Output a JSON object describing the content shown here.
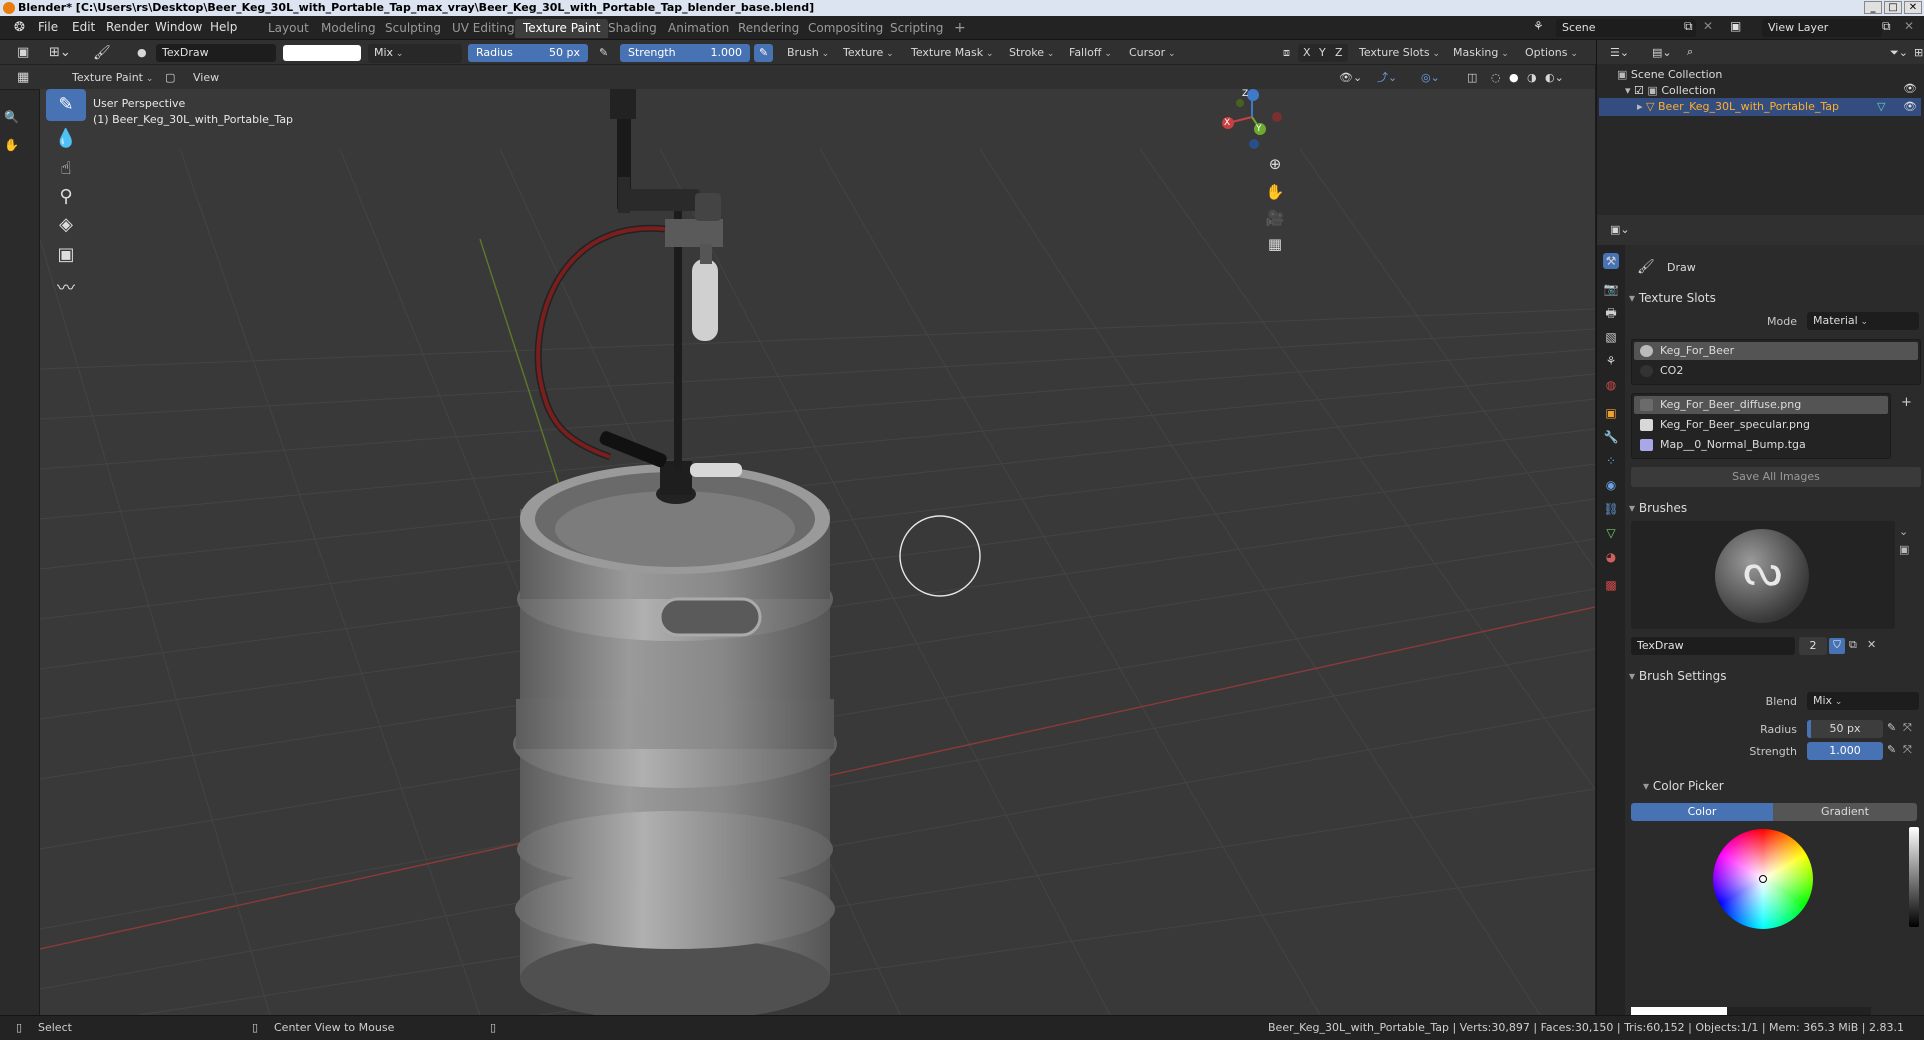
{
  "window": {
    "title": "Blender* [C:\\Users\\rs\\Desktop\\Beer_Keg_30L_with_Portable_Tap_max_vray\\Beer_Keg_30L_with_Portable_Tap_blender_base.blend]"
  },
  "menu": [
    "File",
    "Edit",
    "Render",
    "Window",
    "Help"
  ],
  "workspaces": [
    {
      "label": "Layout",
      "active": false
    },
    {
      "label": "Modeling",
      "active": false
    },
    {
      "label": "Sculpting",
      "active": false
    },
    {
      "label": "UV Editing",
      "active": false
    },
    {
      "label": "Texture Paint",
      "active": true
    },
    {
      "label": "Shading",
      "active": false
    },
    {
      "label": "Animation",
      "active": false
    },
    {
      "label": "Rendering",
      "active": false
    },
    {
      "label": "Compositing",
      "active": false
    },
    {
      "label": "Scripting",
      "active": false
    }
  ],
  "workspace_add": "+",
  "scene": {
    "label": "Scene",
    "view_layer": "View Layer"
  },
  "toolheader": {
    "brush_name": "TexDraw",
    "blend_mode": "Mix",
    "radius_label": "Radius",
    "radius_value": "50 px",
    "strength_label": "Strength",
    "strength_value": "1.000",
    "brush_color": "#ffffff",
    "dropdowns": [
      "Brush",
      "Texture",
      "Texture Mask",
      "Stroke",
      "Falloff",
      "Cursor"
    ],
    "axes": [
      "X",
      "Y",
      "Z"
    ],
    "right_dropdowns": [
      "Texture Slots",
      "Masking",
      "Options"
    ]
  },
  "viewheader": {
    "mode": "Texture Paint",
    "view": "View"
  },
  "viewport": {
    "perspective_label": "User Perspective",
    "object_label": "(1) Beer_Keg_30L_with_Portable_Tap",
    "axis_x": "X",
    "axis_y": "Y",
    "axis_z": "Z"
  },
  "outliner": {
    "root": "Scene Collection",
    "collection": "Collection",
    "object": "Beer_Keg_30L_with_Portable_Tap"
  },
  "properties": {
    "tool_name": "Draw",
    "texture_slots": {
      "header": "Texture Slots",
      "mode_label": "Mode",
      "mode_value": "Material",
      "materials": [
        "Keg_For_Beer",
        "CO2"
      ],
      "images": [
        {
          "name": "Keg_For_Beer_diffuse.png",
          "color": "#6b6b6b"
        },
        {
          "name": "Keg_For_Beer_specular.png",
          "color": "#d8d8d8"
        },
        {
          "name": "Map__0_Normal_Bump.tga",
          "color": "#a8a8e8"
        }
      ],
      "save_all": "Save All Images"
    },
    "brushes": {
      "header": "Brushes",
      "brush_name": "TexDraw",
      "users": "2"
    },
    "brush_settings": {
      "header": "Brush Settings",
      "blend_label": "Blend",
      "blend_value": "Mix",
      "radius_label": "Radius",
      "radius_value": "50 px",
      "strength_label": "Strength",
      "strength_value": "1.000"
    },
    "color_picker": {
      "header": "Color Picker",
      "tabs": [
        "Color",
        "Gradient"
      ]
    }
  },
  "statusbar": {
    "select": "Select",
    "center_view": "Center View to Mouse",
    "info": "Beer_Keg_30L_with_Portable_Tap | Verts:30,897 | Faces:30,150 | Tris:60,152 | Objects:1/1 | Mem: 365.3 MiB | 2.83.1"
  },
  "colors": {
    "accent": "#4772b3",
    "header_bg": "#303030",
    "viewport_bg": "#393939"
  }
}
